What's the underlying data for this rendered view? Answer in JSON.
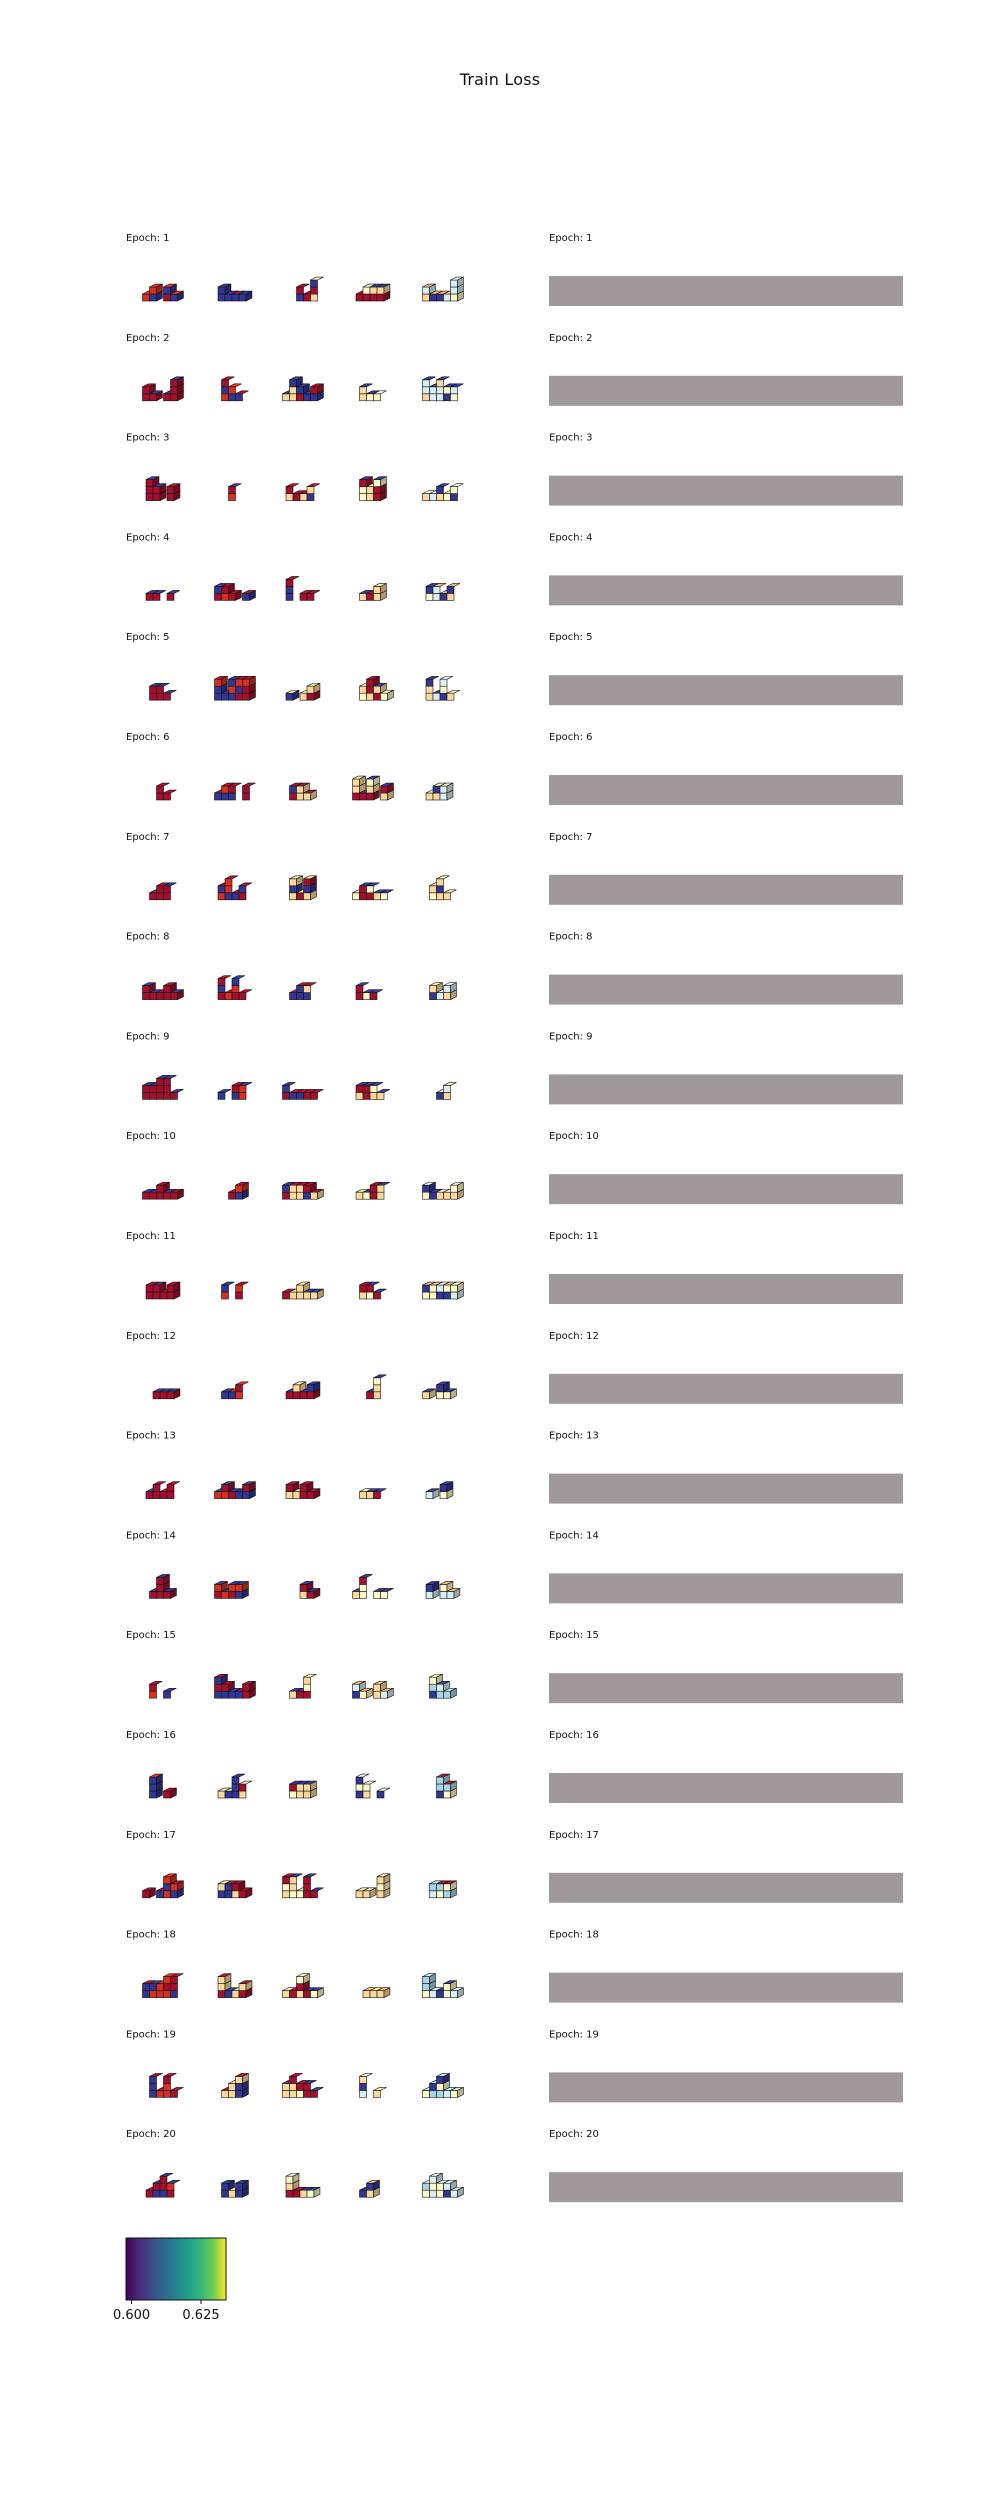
{
  "figure": {
    "title": "Train Loss"
  },
  "chart_data": {
    "type": "heatmap",
    "title": "Train Loss",
    "panel_label_prefix": "Epoch: ",
    "epochs": [
      1,
      2,
      3,
      4,
      5,
      6,
      7,
      8,
      9,
      10,
      11,
      12,
      13,
      14,
      15,
      16,
      17,
      18,
      19,
      20
    ],
    "samples_per_epoch": 5,
    "right_panel_color": "#a0989b",
    "voxel_colors": {
      "red": "#a50f2d",
      "red_light": "#d7301f",
      "navy": "#313695",
      "orange": "#f4a460",
      "peach": "#fdd89a",
      "cream": "#fffbc8",
      "pale_blue": "#d6eef5",
      "light_blue": "#a6d4e8",
      "outline": "#111111"
    },
    "colorbar": {
      "colormap": "viridis",
      "range": [
        0.598,
        0.634
      ],
      "ticks": [
        0.6,
        0.625
      ],
      "tick_labels": [
        "0.600",
        "0.625"
      ]
    }
  }
}
